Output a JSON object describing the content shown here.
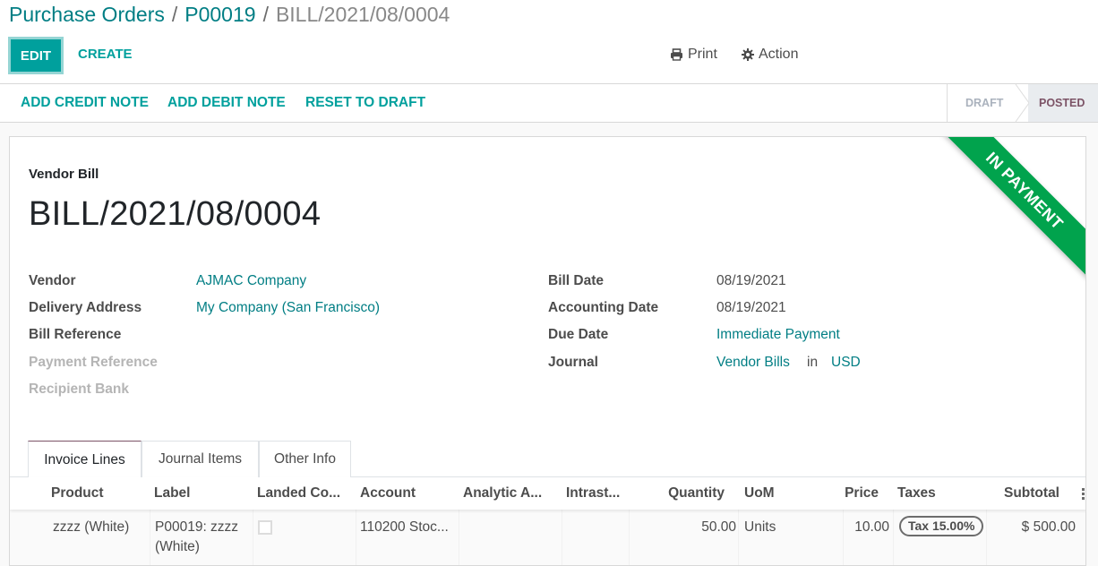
{
  "breadcrumb": {
    "items": [
      "Purchase Orders",
      "P00019"
    ],
    "separator": "/",
    "current": "BILL/2021/08/0004"
  },
  "toolbar": {
    "edit_label": "EDIT",
    "create_label": "CREATE",
    "print_label": "Print",
    "action_label": "Action"
  },
  "statusbar": {
    "buttons": [
      "ADD CREDIT NOTE",
      "ADD DEBIT NOTE",
      "RESET TO DRAFT"
    ],
    "stages": [
      {
        "label": "DRAFT",
        "active": false
      },
      {
        "label": "POSTED",
        "active": true
      }
    ]
  },
  "ribbon": {
    "label": "IN PAYMENT",
    "color": "#01a34d"
  },
  "document": {
    "type": "Vendor Bill",
    "number": "BILL/2021/08/0004"
  },
  "left_fields": [
    {
      "label": "Vendor",
      "value": "AJMAC Company"
    },
    {
      "label": "Delivery Address",
      "value": "My Company (San Francisco)"
    },
    {
      "label": "Bill Reference",
      "value": ""
    },
    {
      "label": "Payment Reference",
      "value": ""
    },
    {
      "label": "Recipient Bank",
      "value": ""
    }
  ],
  "right_fields": [
    {
      "label": "Bill Date",
      "value": "08/19/2021"
    },
    {
      "label": "Accounting Date",
      "value": "08/19/2021"
    },
    {
      "label": "Due Date",
      "value": "Immediate Payment"
    },
    {
      "label": "Journal",
      "value": "Vendor Bills",
      "in_label": "in",
      "currency": "USD"
    }
  ],
  "tabs": [
    {
      "label": "Invoice Lines",
      "active": true
    },
    {
      "label": "Journal Items",
      "active": false
    },
    {
      "label": "Other Info",
      "active": false
    }
  ],
  "table": {
    "columns": [
      "Product",
      "Label",
      "Landed Co...",
      "Account",
      "Analytic A...",
      "Intrast...",
      "Quantity",
      "UoM",
      "Price",
      "Taxes",
      "Subtotal"
    ],
    "rows": [
      {
        "product": "zzzz (White)",
        "label_line1": "P00019: zzzz",
        "label_line2": "(White)",
        "landed_cost": false,
        "account": "110200 Stoc...",
        "analytic": "",
        "intrastat": "",
        "quantity": "50.00",
        "uom": "Units",
        "price": "10.00",
        "tax": "Tax 15.00%",
        "subtotal": "$ 500.00"
      }
    ]
  },
  "colors": {
    "primary": "#00a09d",
    "link": "#017e84",
    "stage_active": "#7c5366"
  }
}
